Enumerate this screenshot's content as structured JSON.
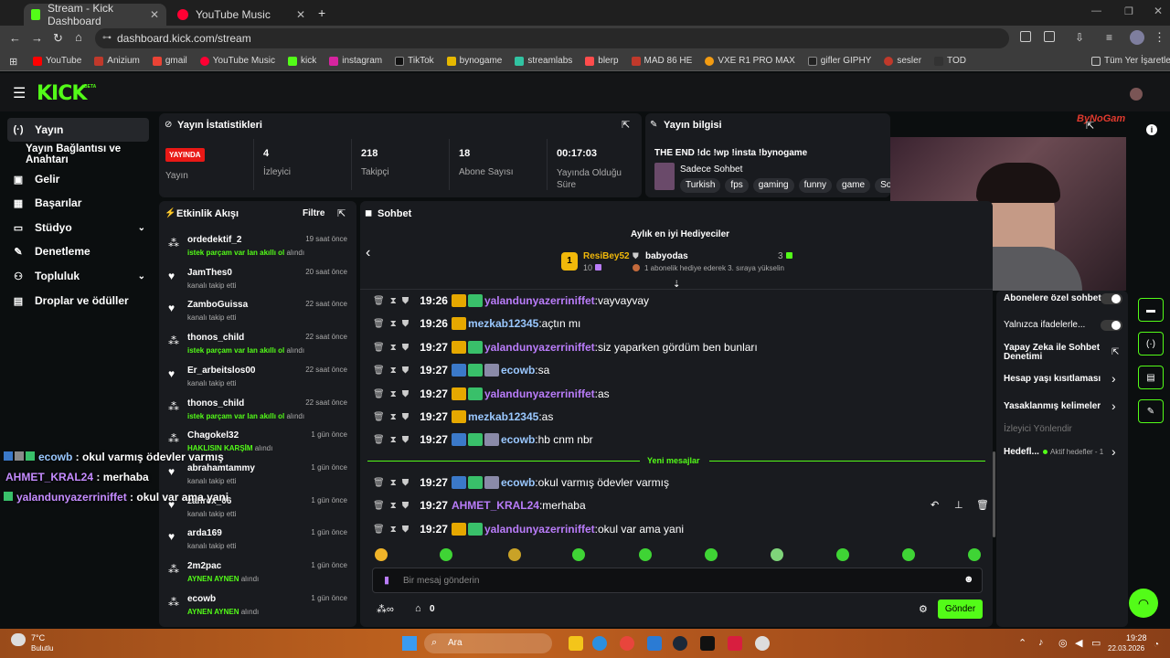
{
  "browser": {
    "tabs": [
      {
        "title": "Stream - Kick Dashboard",
        "active": true
      },
      {
        "title": "YouTube Music",
        "active": false
      }
    ],
    "url": "dashboard.kick.com/stream",
    "bookmarks": [
      "YouTube",
      "Anizium",
      "gmail",
      "YouTube Music",
      "kick",
      "instagram",
      "TikTok",
      "bynogame",
      "streamlabs",
      "blerp",
      "MAD 86 HE",
      "VXE R1 PRO MAX",
      "gifler GIPHY",
      "sesler",
      "TOD"
    ],
    "all_bookmarks": "Tüm Yer İşaretleri"
  },
  "kick": {
    "logo": "KICK",
    "beta": "BETA"
  },
  "sidebar": {
    "items": [
      {
        "label": "Yayın",
        "icon": "broadcast-icon"
      },
      {
        "label": "Yayın Bağlantısı ve Anahtarı",
        "icon": ""
      },
      {
        "label": "Gelir",
        "icon": "income-icon"
      },
      {
        "label": "Başarılar",
        "icon": "achievements-icon"
      },
      {
        "label": "Stüdyo",
        "icon": "studio-icon"
      },
      {
        "label": "Denetleme",
        "icon": "moderation-icon"
      },
      {
        "label": "Topluluk",
        "icon": "community-icon"
      },
      {
        "label": "Droplar ve ödüller",
        "icon": "drops-icon"
      }
    ]
  },
  "stats": {
    "title": "Yayın İstatistikleri",
    "live_badge": "YAYINDA",
    "items": [
      {
        "value": "",
        "label": "Yayın"
      },
      {
        "value": "4",
        "label": "İzleyici"
      },
      {
        "value": "218",
        "label": "Takipçi"
      },
      {
        "value": "18",
        "label": "Abone Sayısı"
      },
      {
        "value": "00:17:03",
        "label": "Yayında Olduğu Süre"
      }
    ]
  },
  "info": {
    "title": "Yayın bilgisi",
    "stream_title": "THE END !dc !wp !insta !bynogame",
    "category": "Sadece Sohbet",
    "tags": [
      "Turkish",
      "fps",
      "gaming",
      "funny",
      "game",
      "Soh"
    ]
  },
  "activity": {
    "title": "Etkinlik Akışı",
    "filter": "Filtre",
    "items": [
      {
        "name": "ordedektif_2",
        "desc_green": "istek parçam var lan akıllı ol",
        "desc": " alındı",
        "time": "19 saat önce",
        "icon": "redeem"
      },
      {
        "name": "JamThes0",
        "desc_green": "",
        "desc": "kanalı takip etti",
        "time": "20 saat önce",
        "icon": "follow"
      },
      {
        "name": "ZamboGuissa",
        "desc_green": "",
        "desc": "kanalı takip etti",
        "time": "22 saat önce",
        "icon": "follow"
      },
      {
        "name": "thonos_child",
        "desc_green": "istek parçam var lan akıllı ol",
        "desc": " alındı",
        "time": "22 saat önce",
        "icon": "redeem"
      },
      {
        "name": "Er_arbeitslos00",
        "desc_green": "",
        "desc": "kanalı takip etti",
        "time": "22 saat önce",
        "icon": "follow"
      },
      {
        "name": "thonos_child",
        "desc_green": "istek parçam var lan akıllı ol",
        "desc": " alındı",
        "time": "22 saat önce",
        "icon": "redeem"
      },
      {
        "name": "Chagokel32",
        "desc_green": "HAKLISIN KARŞİM",
        "desc": " alındı",
        "time": "1 gün önce",
        "icon": "redeem"
      },
      {
        "name": "abrahamtammy",
        "desc_green": "",
        "desc": "kanalı takip etti",
        "time": "1 gün önce",
        "icon": "follow"
      },
      {
        "name": "zahrex_06",
        "desc_green": "",
        "desc": "kanalı takip etti",
        "time": "1 gün önce",
        "icon": "follow"
      },
      {
        "name": "arda169",
        "desc_green": "",
        "desc": "kanalı takip etti",
        "time": "1 gün önce",
        "icon": "follow"
      },
      {
        "name": "2m2pac",
        "desc_green": "AYNEN AYNEN",
        "desc": " alındı",
        "time": "1 gün önce",
        "icon": "redeem"
      },
      {
        "name": "ecowb",
        "desc_green": "AYNEN AYNEN",
        "desc": " alındı",
        "time": "1 gün önce",
        "icon": "redeem"
      }
    ]
  },
  "chat": {
    "title": "Sohbet",
    "gifters_title": "Aylık en iyi Hediyeciler",
    "top_gifter": {
      "rank": "1",
      "name": "ResiBey52",
      "count": "10"
    },
    "second_gifter": {
      "name": "babyodas",
      "count": "3",
      "note": "1 abonelik hediye ederek 3. sıraya yükselin"
    },
    "new_messages": "Yeni mesajlar",
    "messages": [
      {
        "time": "19:26",
        "user": "yalandunyazerriniffet",
        "color": "#b97cf9",
        "text": "vayvayvay"
      },
      {
        "time": "19:26",
        "user": "mezkab12345",
        "color": "#9ac8ff",
        "text": "açtın mı"
      },
      {
        "time": "19:27",
        "user": "yalandunyazerriniffet",
        "color": "#b97cf9",
        "text": "siz yaparken gördüm ben bunları"
      },
      {
        "time": "19:27",
        "user": "ecowb",
        "color": "#9ac8ff",
        "text": "sa"
      },
      {
        "time": "19:27",
        "user": "yalandunyazerriniffet",
        "color": "#b97cf9",
        "text": "as"
      },
      {
        "time": "19:27",
        "user": "mezkab12345",
        "color": "#9ac8ff",
        "text": "as"
      },
      {
        "time": "19:27",
        "user": "ecowb",
        "color": "#9ac8ff",
        "text": "hb cnm nbr"
      },
      {
        "time": "19:27",
        "user": "ecowb",
        "color": "#9ac8ff",
        "text": "okul varmış ödevler varmış"
      },
      {
        "time": "19:27",
        "user": "AHMET_KRAL24",
        "color": "#b97cf9",
        "text": "merhaba"
      },
      {
        "time": "19:27",
        "user": "yalandunyazerriniffet",
        "color": "#b97cf9",
        "text": "okul var ama yani"
      }
    ],
    "input_placeholder": "Bir mesaj gönderin",
    "points": "0",
    "send": "Gönder"
  },
  "settings": {
    "items": [
      {
        "label": "Abonelere özel sohbet",
        "kind": "toggle"
      },
      {
        "label": "Yalnızca ifadelerle...",
        "kind": "toggle"
      },
      {
        "label": "Yapay Zeka ile Sohbet Denetimi",
        "kind": "link"
      },
      {
        "label": "Hesap yaşı kısıtlaması",
        "kind": "chevron"
      },
      {
        "label": "Yasaklanmış kelimeler",
        "kind": "chevron"
      },
      {
        "label": "İzleyici Yönlendir",
        "kind": "muted"
      },
      {
        "label": "Hedefl...",
        "kind": "chevron"
      }
    ],
    "goal_note": "Aktif hedefler - 1"
  },
  "overlay": [
    {
      "user": "ecowb",
      "text": "okul varmış ödevler varmış",
      "color": "#9ac8ff"
    },
    {
      "user": "AHMET_KRAL24",
      "text": "merhaba",
      "color": "#c58cff"
    },
    {
      "user": "yalandunyazerriniffet",
      "text": "okul var ama yani",
      "color": "#c58cff"
    }
  ],
  "overlay_logo": "ByNoGam",
  "taskbar": {
    "weather_temp": "7°C",
    "weather_desc": "Bulutlu",
    "search": "Ara",
    "time": "19:28",
    "date": "22.03.2026"
  }
}
